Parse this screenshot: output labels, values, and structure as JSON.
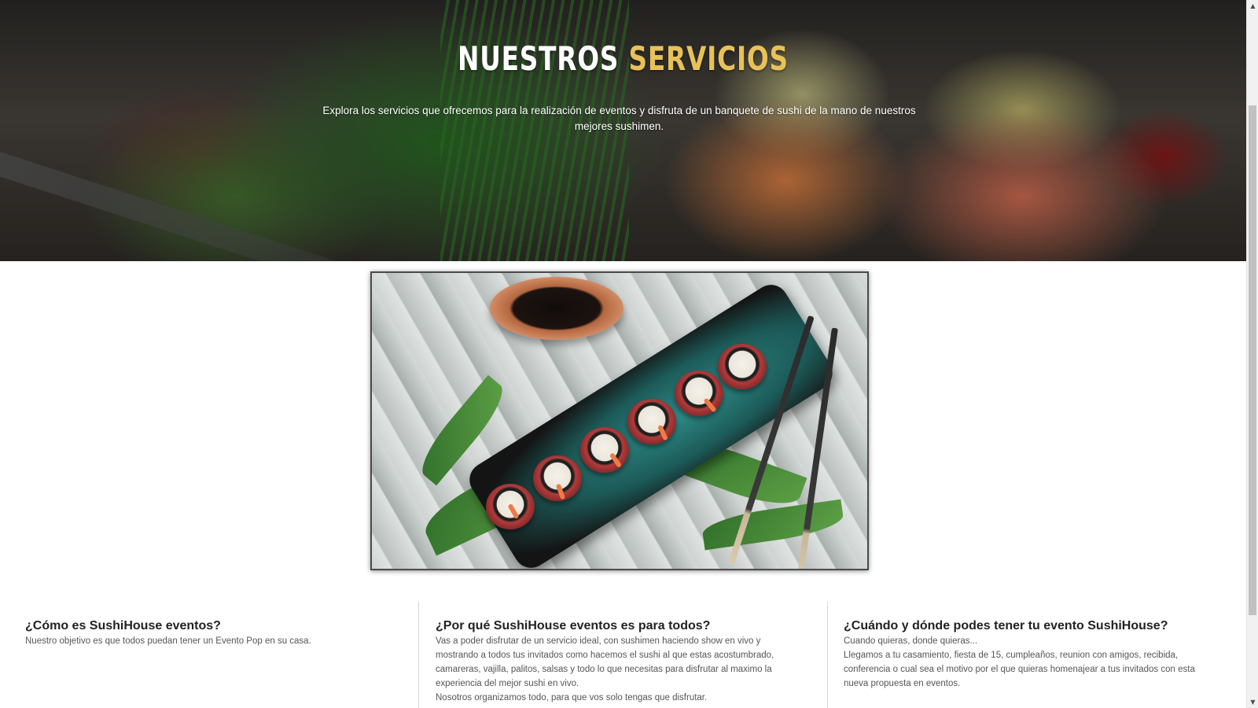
{
  "hero": {
    "title_white": "NUESTROS",
    "title_accent": "SERVICIOS",
    "description": "Explora los servicios que ofrecemos para la realización de eventos y disfruta de un banquete de sushi de la mano de nuestros mejores sushimen.",
    "accent_color": "#e7c15a"
  },
  "feature_image": {
    "subject": "sushi-roll-platter"
  },
  "columns": [
    {
      "heading": "¿Cómo es SushiHouse eventos?",
      "paragraphs": [
        "Nuestro objetivo es que todos puedan tener un Evento Pop en su casa."
      ]
    },
    {
      "heading": "¿Por qué SushiHouse eventos es para todos?",
      "paragraphs": [
        "Vas a poder disfrutar de un servicio ideal, con sushimen haciendo show en vivo y mostrando a todos tus invitados como hacemos el sushi al que estas acostumbrado, camareras, vajilla, palitos, salsas y todo lo que necesitas para disfrutar al maximo la experiencia del mejor sushi en vivo.",
        "Nosotros organizamos todo, para que vos solo tengas que disfrutar."
      ]
    },
    {
      "heading": "¿Cuándo y dónde podes tener tu evento SushiHouse?",
      "paragraphs": [
        "Cuando quieras, donde quieras...",
        "Llegamos a tu casamiento, fiesta de 15, cumpleaños, reunion con amigos, recibida, conferencia o cual sea el motivo por el que quieras homenajear a tus invitados con esta nueva propuesta en eventos."
      ]
    }
  ],
  "scrollbar": {
    "up_icon": "triangle-up",
    "down_icon": "triangle-down"
  }
}
